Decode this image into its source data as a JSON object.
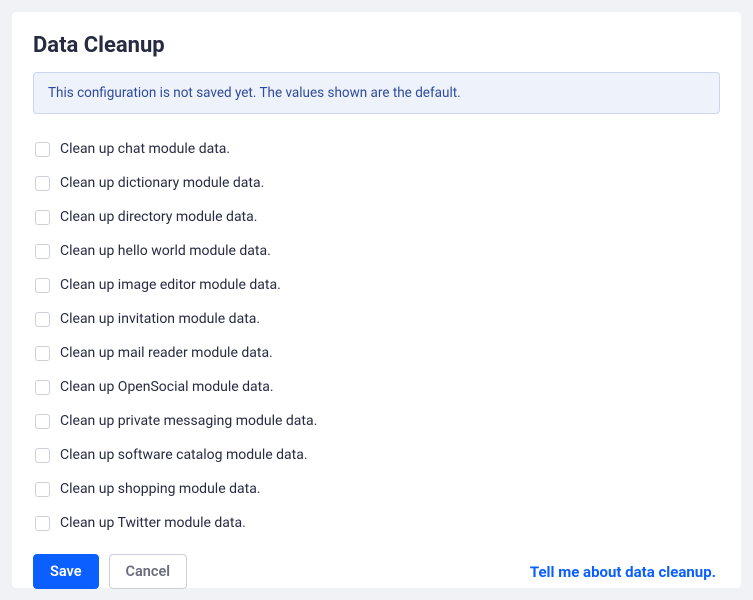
{
  "title": "Data Cleanup",
  "infoBanner": "This configuration is not saved yet. The values shown are the default.",
  "options": [
    {
      "id": "chat",
      "label": "Clean up chat module data.",
      "checked": false
    },
    {
      "id": "dictionary",
      "label": "Clean up dictionary module data.",
      "checked": false
    },
    {
      "id": "directory",
      "label": "Clean up directory module data.",
      "checked": false
    },
    {
      "id": "hello-world",
      "label": "Clean up hello world module data.",
      "checked": false
    },
    {
      "id": "image-editor",
      "label": "Clean up image editor module data.",
      "checked": false
    },
    {
      "id": "invitation",
      "label": "Clean up invitation module data.",
      "checked": false
    },
    {
      "id": "mail-reader",
      "label": "Clean up mail reader module data.",
      "checked": false
    },
    {
      "id": "opensocial",
      "label": "Clean up OpenSocial module data.",
      "checked": false
    },
    {
      "id": "private-messaging",
      "label": "Clean up private messaging module data.",
      "checked": false
    },
    {
      "id": "software-catalog",
      "label": "Clean up software catalog module data.",
      "checked": false
    },
    {
      "id": "shopping",
      "label": "Clean up shopping module data.",
      "checked": false
    },
    {
      "id": "twitter",
      "label": "Clean up Twitter module data.",
      "checked": false
    }
  ],
  "buttons": {
    "saveLabel": "Save",
    "cancelLabel": "Cancel"
  },
  "helpLink": "Tell me about data cleanup."
}
